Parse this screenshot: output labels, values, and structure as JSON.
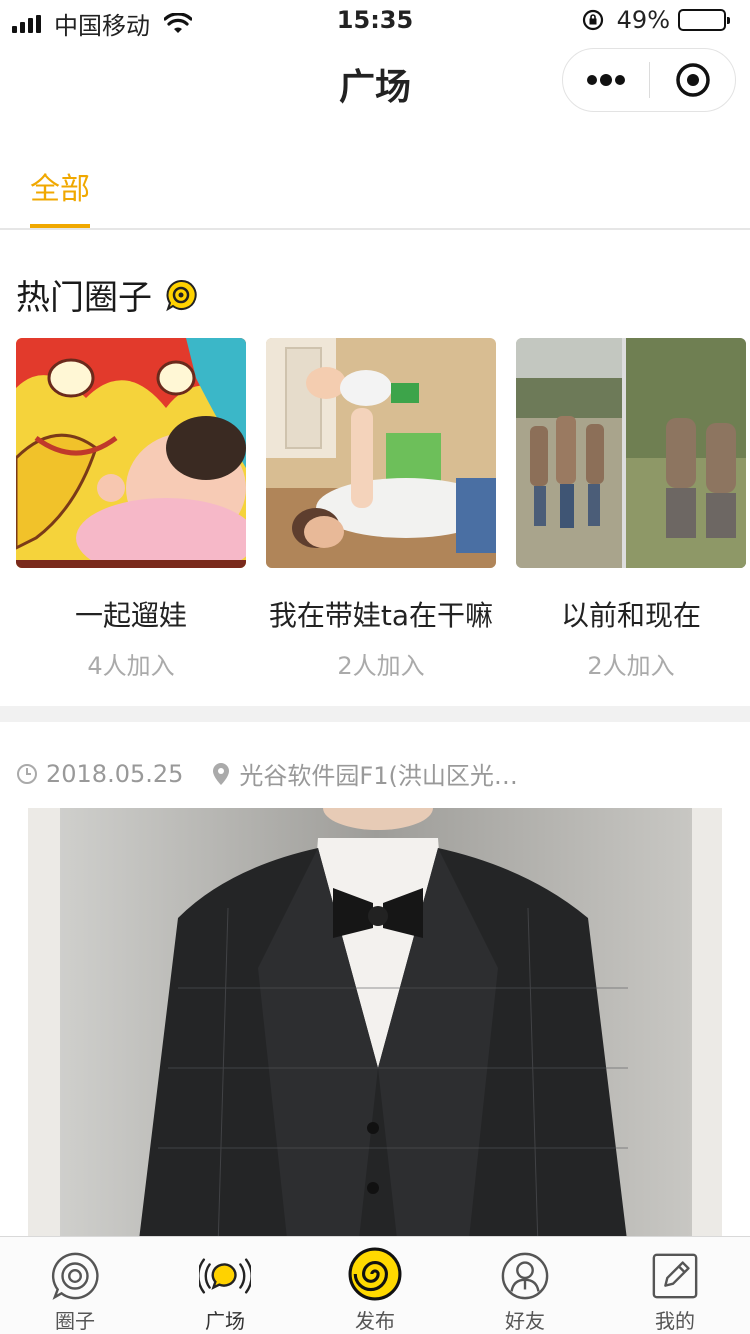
{
  "status_bar": {
    "carrier": "中国移动",
    "time": "15:35",
    "battery_percent": "49%",
    "battery_level": 0.49,
    "icons": [
      "signal-icon",
      "wifi-icon",
      "rotation-lock-icon",
      "battery-icon"
    ]
  },
  "nav": {
    "title": "广场",
    "more_icon": "more-dots-icon",
    "close_icon": "target-close-icon"
  },
  "tabs": [
    {
      "label": "全部",
      "active": true
    }
  ],
  "hot_circles": {
    "title": "热门圈子",
    "icon": "chat-bubble-icon",
    "items": [
      {
        "name": "一起遛娃",
        "count": "4人加入"
      },
      {
        "name": "我在带娃ta在干嘛",
        "count": "2人加入"
      },
      {
        "name": "以前和现在",
        "count": "2人加入"
      }
    ]
  },
  "post": {
    "date": "2018.05.25",
    "location": "光谷软件园F1(洪山区光…",
    "image_alt": "man in plaid suit with bow tie"
  },
  "tabbar": {
    "items": [
      {
        "label": "圈子",
        "icon": "circle-ripple-icon",
        "active": false
      },
      {
        "label": "广场",
        "icon": "broadcast-bubble-icon",
        "active": true
      },
      {
        "label": "发布",
        "icon": "spiral-publish-icon",
        "active": false
      },
      {
        "label": "好友",
        "icon": "friend-person-icon",
        "active": false
      },
      {
        "label": "我的",
        "icon": "edit-note-icon",
        "active": false
      }
    ]
  },
  "colors": {
    "accent": "#f0a800",
    "publish_yellow": "#ffd900"
  }
}
